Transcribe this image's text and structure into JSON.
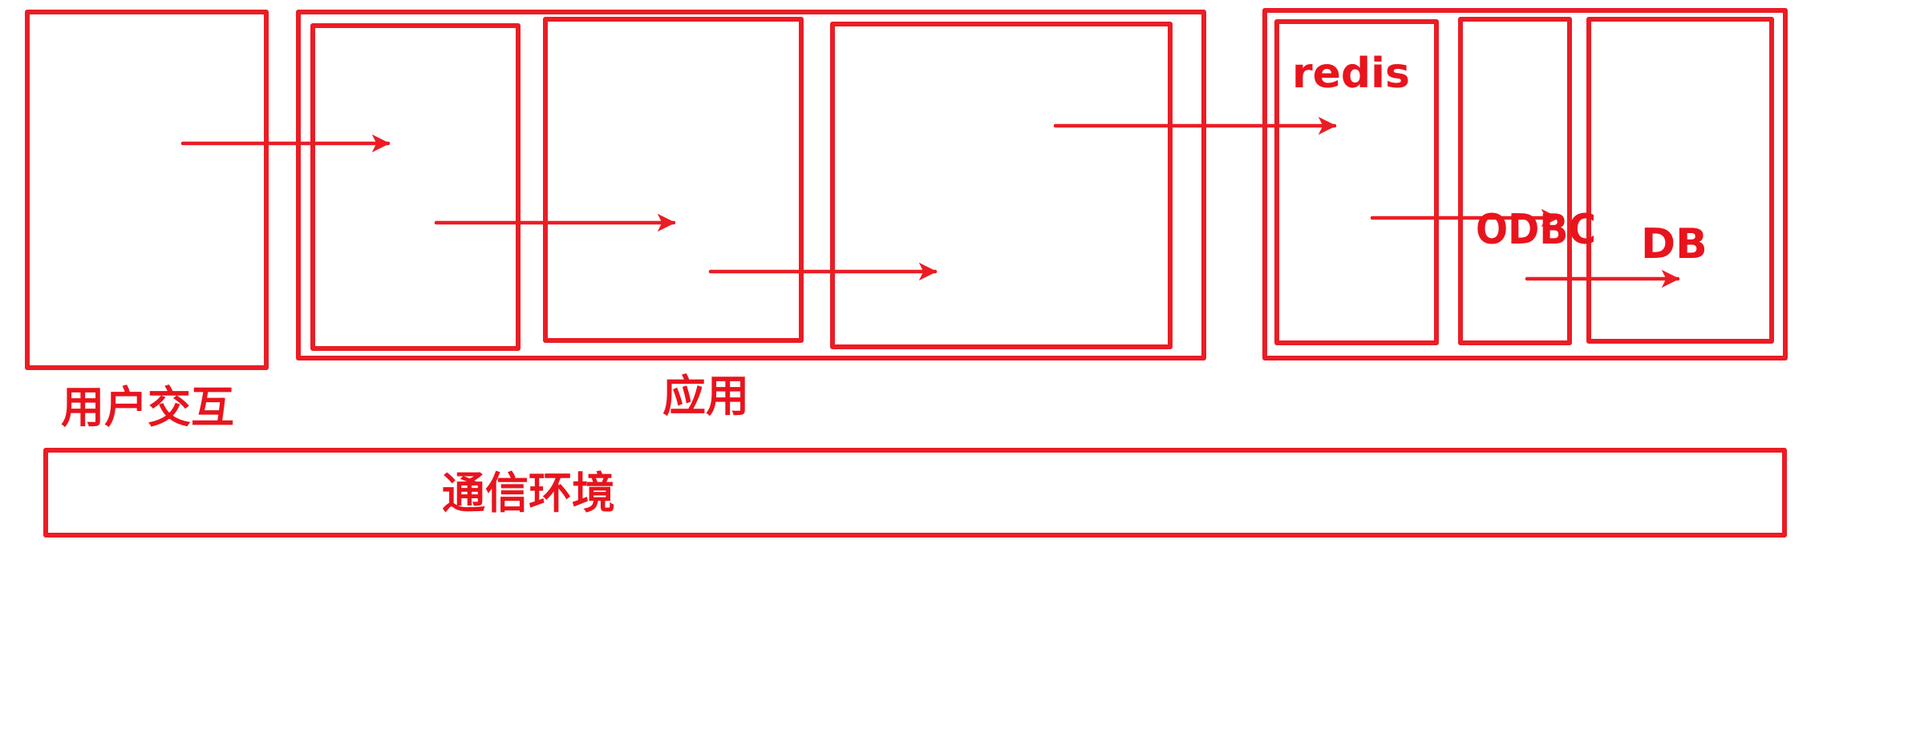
{
  "colors": {
    "stroke": "#ea1d25",
    "text": "#e8141d",
    "background": "#ffffff"
  },
  "labels": {
    "user_interaction": "用户交互",
    "application": "应用",
    "communication_environment": "通信环境",
    "redis": "redis",
    "odbc": "ODBC",
    "db": "DB"
  }
}
